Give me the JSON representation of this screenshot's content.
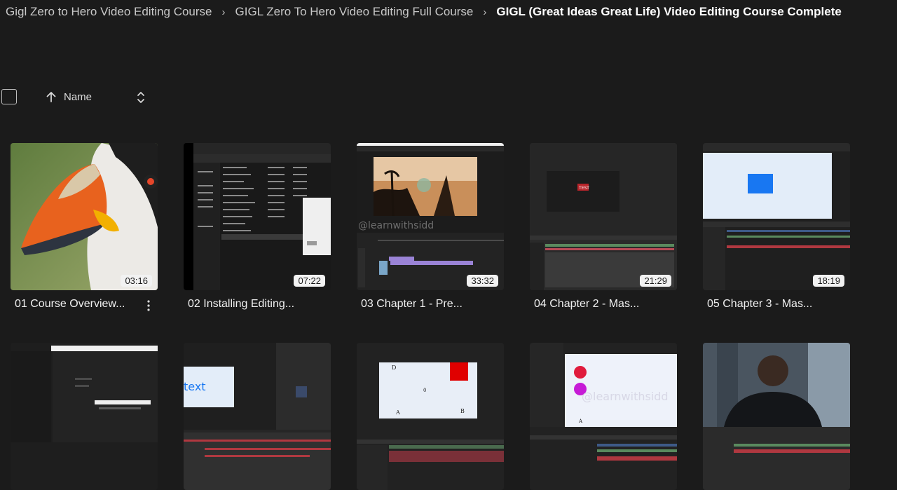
{
  "breadcrumb": {
    "items": [
      "Gigl Zero to Hero Video Editing Course",
      "GIGL Zero To Hero Video Editing Full Course",
      "GIGL (Great Ideas Great Life) Video Editing Course Complete"
    ],
    "separator": "›"
  },
  "toolbar": {
    "sort_label": "Name",
    "sort_direction_icon": "arrow-up-icon",
    "sort_toggle_icon": "unfold-icon",
    "checkbox_checked": false
  },
  "videos": [
    {
      "title": "01 Course Overview...",
      "duration": "03:16",
      "thumb": "puffin"
    },
    {
      "title": "02 Installing Editing...",
      "duration": "07:22",
      "thumb": "file-explorer"
    },
    {
      "title": "03 Chapter 1 - Pre...",
      "duration": "33:32",
      "thumb": "editor-palms"
    },
    {
      "title": "04 Chapter 2 - Mas...",
      "duration": "21:29",
      "thumb": "editor-text"
    },
    {
      "title": "05 Chapter 3 - Mas...",
      "duration": "18:19",
      "thumb": "editor-blue-square"
    },
    {
      "title": "",
      "duration": "",
      "thumb": "dialog"
    },
    {
      "title": "",
      "duration": "",
      "thumb": "editor-text-tool"
    },
    {
      "title": "",
      "duration": "",
      "thumb": "editor-red-square"
    },
    {
      "title": "",
      "duration": "",
      "thumb": "editor-circles"
    },
    {
      "title": "",
      "duration": "",
      "thumb": "man-hallway"
    }
  ],
  "thumb_text": {
    "watermark": "@learnwithsidd",
    "text_label": "text",
    "test_label": "TEST",
    "letters": [
      "D",
      "0",
      "A",
      "B"
    ],
    "circle_letter": "A"
  },
  "colors": {
    "background": "#1b1b1b",
    "text": "#e6e6e6",
    "badge_bg": "#f2f2f2",
    "accent_blue": "#1877f2",
    "accent_red": "#e00000",
    "accent_magenta": "#c61bd6"
  }
}
